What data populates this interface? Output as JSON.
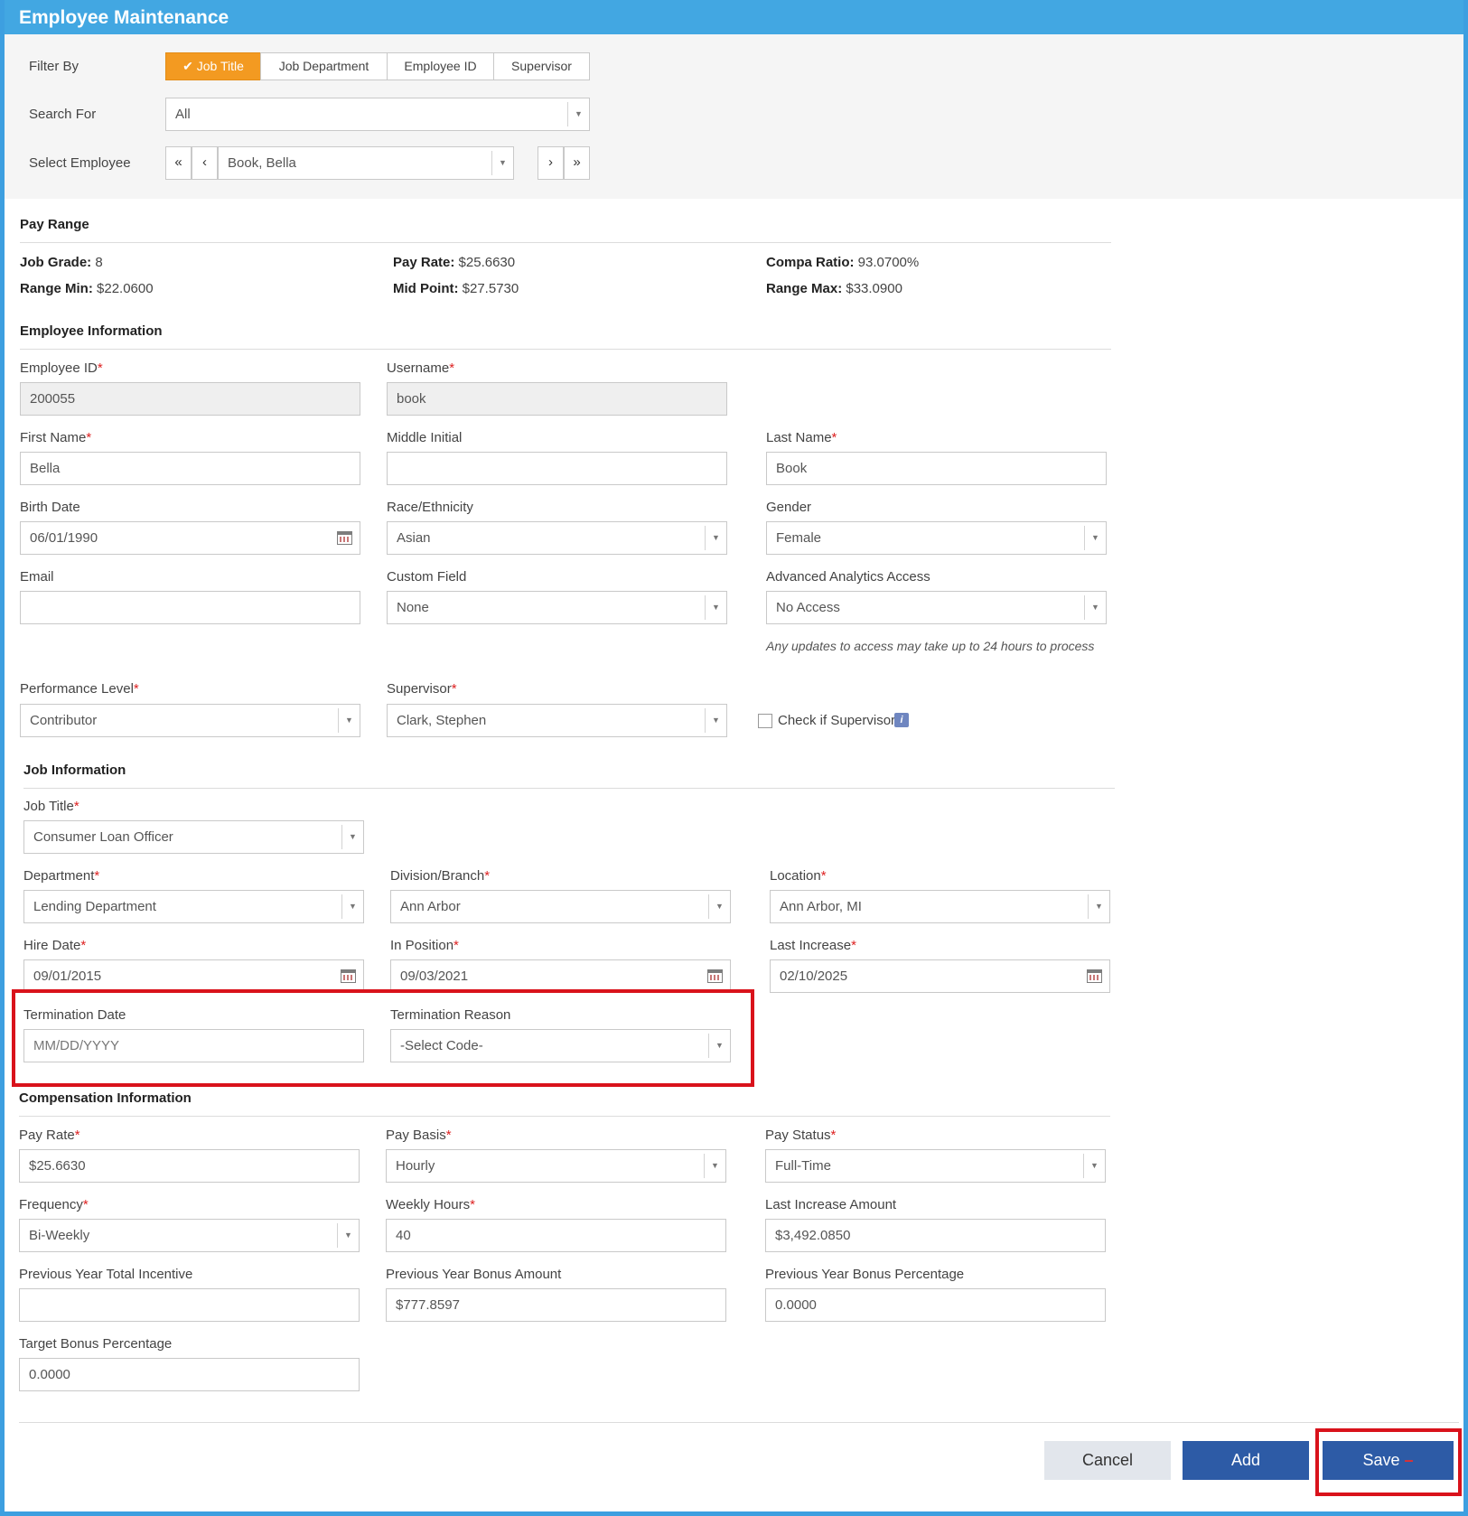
{
  "title": "Employee Maintenance",
  "filter": {
    "filter_by_label": "Filter By",
    "options": [
      "Job Title",
      "Job Department",
      "Employee ID",
      "Supervisor"
    ],
    "selected": "Job Title",
    "search_for_label": "Search For",
    "search_for_value": "All",
    "select_employee_label": "Select Employee",
    "select_employee_value": "Book, Bella"
  },
  "pay_range": {
    "heading": "Pay Range",
    "job_grade_label": "Job Grade:",
    "job_grade": "8",
    "pay_rate_label": "Pay Rate:",
    "pay_rate": "$25.6630",
    "compa_ratio_label": "Compa Ratio:",
    "compa_ratio": "93.0700%",
    "range_min_label": "Range Min:",
    "range_min": "$22.0600",
    "mid_point_label": "Mid Point:",
    "mid_point": "$27.5730",
    "range_max_label": "Range Max:",
    "range_max": "$33.0900"
  },
  "employee_info": {
    "heading": "Employee Information",
    "employee_id_label": "Employee ID",
    "employee_id": "200055",
    "username_label": "Username",
    "username": "book",
    "first_name_label": "First Name",
    "first_name": "Bella",
    "middle_initial_label": "Middle Initial",
    "middle_initial": "",
    "last_name_label": "Last Name",
    "last_name": "Book",
    "birth_date_label": "Birth Date",
    "birth_date": "06/01/1990",
    "race_label": "Race/Ethnicity",
    "race": "Asian",
    "gender_label": "Gender",
    "gender": "Female",
    "email_label": "Email",
    "email": "",
    "custom_field_label": "Custom Field",
    "custom_field": "None",
    "analytics_label": "Advanced Analytics Access",
    "analytics": "No Access",
    "analytics_note": "Any updates to access may take up to 24 hours to process",
    "performance_label": "Performance Level",
    "performance": "Contributor",
    "supervisor_label": "Supervisor",
    "supervisor": "Clark, Stephen",
    "check_supervisor_label": "Check if Supervisor"
  },
  "job_info": {
    "heading": "Job Information",
    "job_title_label": "Job Title",
    "job_title": "Consumer Loan Officer",
    "department_label": "Department",
    "department": "Lending Department",
    "division_label": "Division/Branch",
    "division": "Ann Arbor",
    "location_label": "Location",
    "location": "Ann Arbor, MI",
    "hire_date_label": "Hire Date",
    "hire_date": "09/01/2015",
    "in_position_label": "In Position",
    "in_position": "09/03/2021",
    "last_increase_label": "Last Increase",
    "last_increase": "02/10/2025",
    "termination_date_label": "Termination Date",
    "termination_date_placeholder": "MM/DD/YYYY",
    "termination_reason_label": "Termination Reason",
    "termination_reason": "-Select Code-"
  },
  "compensation": {
    "heading": "Compensation Information",
    "pay_rate_label": "Pay Rate",
    "pay_rate": "$25.6630",
    "pay_basis_label": "Pay Basis",
    "pay_basis": "Hourly",
    "pay_status_label": "Pay Status",
    "pay_status": "Full-Time",
    "frequency_label": "Frequency",
    "frequency": "Bi-Weekly",
    "weekly_hours_label": "Weekly Hours",
    "weekly_hours": "40",
    "last_increase_amount_label": "Last Increase Amount",
    "last_increase_amount": "$3,492.0850",
    "prev_total_incentive_label": "Previous Year Total Incentive",
    "prev_total_incentive": "",
    "prev_bonus_amount_label": "Previous Year Bonus Amount",
    "prev_bonus_amount": "$777.8597",
    "prev_bonus_pct_label": "Previous Year Bonus Percentage",
    "prev_bonus_pct": "0.0000",
    "target_bonus_pct_label": "Target Bonus Percentage",
    "target_bonus_pct": "0.0000"
  },
  "actions": {
    "cancel": "Cancel",
    "add": "Add",
    "save": "Save"
  },
  "required_mark": "*",
  "icons": {
    "check": "checkmark-icon",
    "dropdown": "chevron-down-icon",
    "calendar": "calendar-icon",
    "info": "info-icon"
  },
  "colors": {
    "header": "#42a7e2",
    "active_filter": "#f39a21",
    "primary_button": "#2d5ba6",
    "highlight": "#d9121b",
    "required": "#dd2222"
  }
}
